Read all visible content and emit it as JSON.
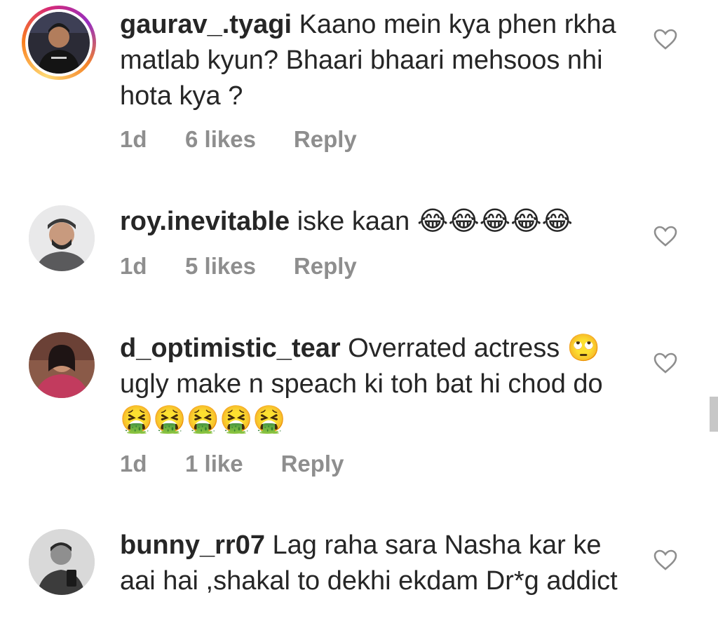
{
  "comments": [
    {
      "username": "gaurav_.tyagi",
      "text": "Kaano mein kya phen rkha matlab kyun? Bhaari bhaari mehsoos nhi hota kya ?",
      "time": "1d",
      "likes": "6 likes",
      "reply": "Reply",
      "avatar": "avatar-story-ring"
    },
    {
      "username": "roy.inevitable",
      "text": "iske kaan",
      "emoji": [
        "😂",
        "😂",
        "😂",
        "😂",
        "😂"
      ],
      "time": "1d",
      "likes": "5 likes",
      "reply": "Reply",
      "avatar": "avatar"
    },
    {
      "username": "d_optimistic_tear",
      "text_a": "Overrated actress",
      "emoji_a": "🙄",
      "text_b": "ugly make n speach ki toh bat hi chod do",
      "emoji_b": [
        "🤮",
        "🤮",
        "🤮",
        "🤮",
        "🤮"
      ],
      "time": "1d",
      "likes": "1 like",
      "reply": "Reply",
      "avatar": "avatar"
    },
    {
      "username": "bunny_rr07",
      "text": "Lag raha sara Nasha kar ke aai hai ,shakal to dekhi ekdam Dr*g addict",
      "avatar": "avatar"
    }
  ],
  "icons": {
    "like": "heart-outline-icon"
  },
  "colors": {
    "text": "#262626",
    "meta": "#8e8e8e"
  }
}
